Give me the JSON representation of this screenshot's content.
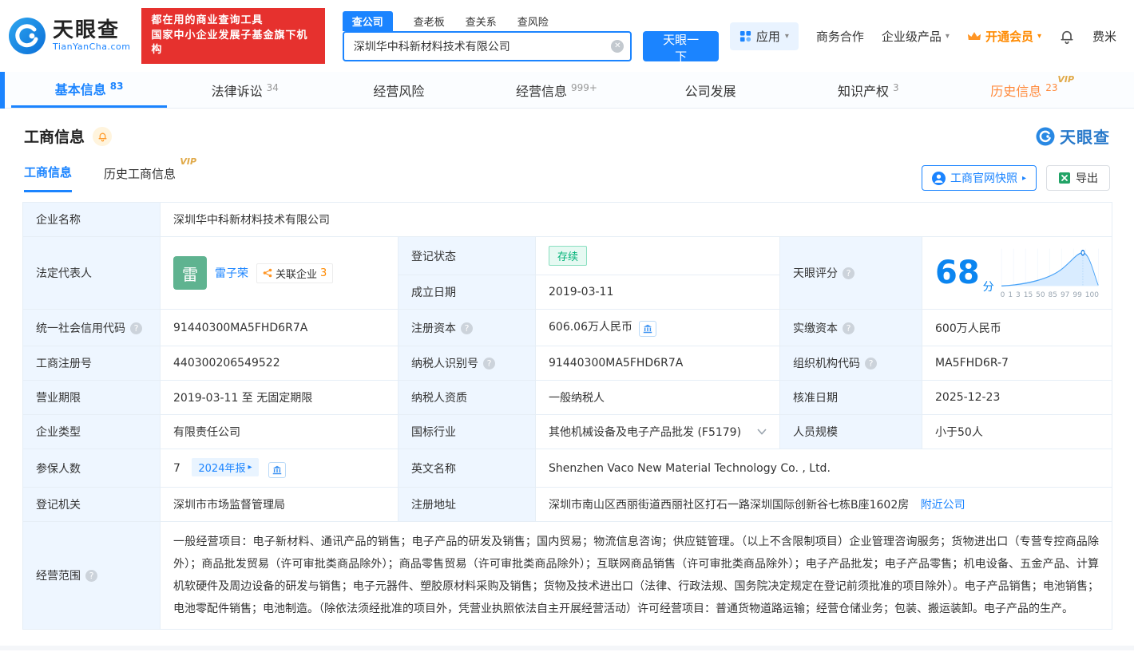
{
  "icons": {
    "help": "?",
    "caret_down": "▾",
    "arrow_right": "▸",
    "clear": "✕"
  },
  "header": {
    "logo_brand": "天眼查",
    "logo_domain": "TianYanCha.com",
    "banner_line1": "都在用的商业查询工具",
    "banner_line2": "国家中小企业发展子基金旗下机构",
    "search_tabs": [
      {
        "label": "查公司"
      },
      {
        "label": "查老板"
      },
      {
        "label": "查关系"
      },
      {
        "label": "查风险"
      }
    ],
    "search_value": "深圳华中科新材料技术有限公司",
    "search_button": "天眼一下",
    "app_menu": "应用",
    "biz_coop": "商务合作",
    "enterprise_products": "企业级产品",
    "open_vip": "开通会员",
    "username": "费米"
  },
  "nav": {
    "tabs": [
      {
        "label": "基本信息",
        "count": "83"
      },
      {
        "label": "法律诉讼",
        "count": "34"
      },
      {
        "label": "经营风险",
        "count": ""
      },
      {
        "label": "经营信息",
        "count": "999+"
      },
      {
        "label": "公司发展",
        "count": ""
      },
      {
        "label": "知识产权",
        "count": "3"
      },
      {
        "label": "历史信息",
        "count": "23"
      }
    ],
    "vip_badge": "VIP"
  },
  "section": {
    "title": "工商信息",
    "brand": "天眼查"
  },
  "subtabs": {
    "tab1": "工商信息",
    "tab2": "历史工商信息",
    "vip": "VIP",
    "snapshot": "工商官网快照",
    "export": "导出"
  },
  "info": {
    "company_name_label": "企业名称",
    "company_name": "深圳华中科新材料技术有限公司",
    "legal_rep_label": "法定代表人",
    "avatar_char": "雷",
    "legal_rep_name": "雷子荣",
    "related_label": "关联企业",
    "related_count": "3",
    "status_label": "登记状态",
    "status_value": "存续",
    "established_label": "成立日期",
    "established_value": "2019-03-11",
    "score_label": "天眼评分",
    "score_value": "68",
    "score_unit": "分",
    "score_axis": [
      "0",
      "1",
      "3",
      "15",
      "50",
      "85",
      "97",
      "99",
      "100"
    ],
    "uscc_label": "统一社会信用代码",
    "uscc_value": "91440300MA5FHD6R7A",
    "reg_capital_label": "注册资本",
    "reg_capital_value": "606.06万人民币",
    "paid_capital_label": "实缴资本",
    "paid_capital_value": "600万人民币",
    "reg_number_label": "工商注册号",
    "reg_number_value": "440300206549522",
    "taxpayer_id_label": "纳税人识别号",
    "taxpayer_id_value": "91440300MA5FHD6R7A",
    "org_code_label": "组织机构代码",
    "org_code_value": "MA5FHD6R-7",
    "term_label": "营业期限",
    "term_value": "2019-03-11 至 无固定期限",
    "taxpayer_quality_label": "纳税人资质",
    "taxpayer_quality_value": "一般纳税人",
    "approval_date_label": "核准日期",
    "approval_date_value": "2025-12-23",
    "company_type_label": "企业类型",
    "company_type_value": "有限责任公司",
    "industry_label": "国标行业",
    "industry_value": "其他机械设备及电子产品批发 (F5179)",
    "staff_size_label": "人员规模",
    "staff_size_value": "小于50人",
    "insured_label": "参保人数",
    "insured_value": "7",
    "annual_report_badge": "2024年报",
    "english_name_label": "英文名称",
    "english_name_value": "Shenzhen Vaco New Material Technology Co. , Ltd.",
    "authority_label": "登记机关",
    "authority_value": "深圳市市场监督管理局",
    "address_label": "注册地址",
    "address_value": "深圳市南山区西丽街道西丽社区打石一路深圳国际创新谷七栋B座1602房",
    "nearby_link": "附近公司",
    "scope_label": "经营范围",
    "scope_value": "一般经营项目：电子新材料、通讯产品的销售；电子产品的研发及销售；国内贸易；物流信息咨询；供应链管理。（以上不含限制项目）企业管理咨询服务；货物进出口（专营专控商品除外）；商品批发贸易（许可审批类商品除外）；商品零售贸易（许可审批类商品除外）；互联网商品销售（许可审批类商品除外）；电子产品批发；电子产品零售；机电设备、五金产品、计算机软硬件及周边设备的研发与销售；电子元器件、塑胶原材料采购及销售；货物及技术进出口（法律、行政法规、国务院决定规定在登记前须批准的项目除外）。电子产品销售；电池销售；电池零配件销售；电池制造。（除依法须经批准的项目外，凭营业执照依法自主开展经营活动）许可经营项目：普通货物道路运输；经营仓储业务；包装、搬运装卸。电子产品的生产。"
  },
  "colors": {
    "brand_blue": "#1b84ff",
    "banner_red": "#e6312e",
    "vip_gold": "#e0a948",
    "status_green": "#00b277",
    "orange": "#ff8a00"
  }
}
